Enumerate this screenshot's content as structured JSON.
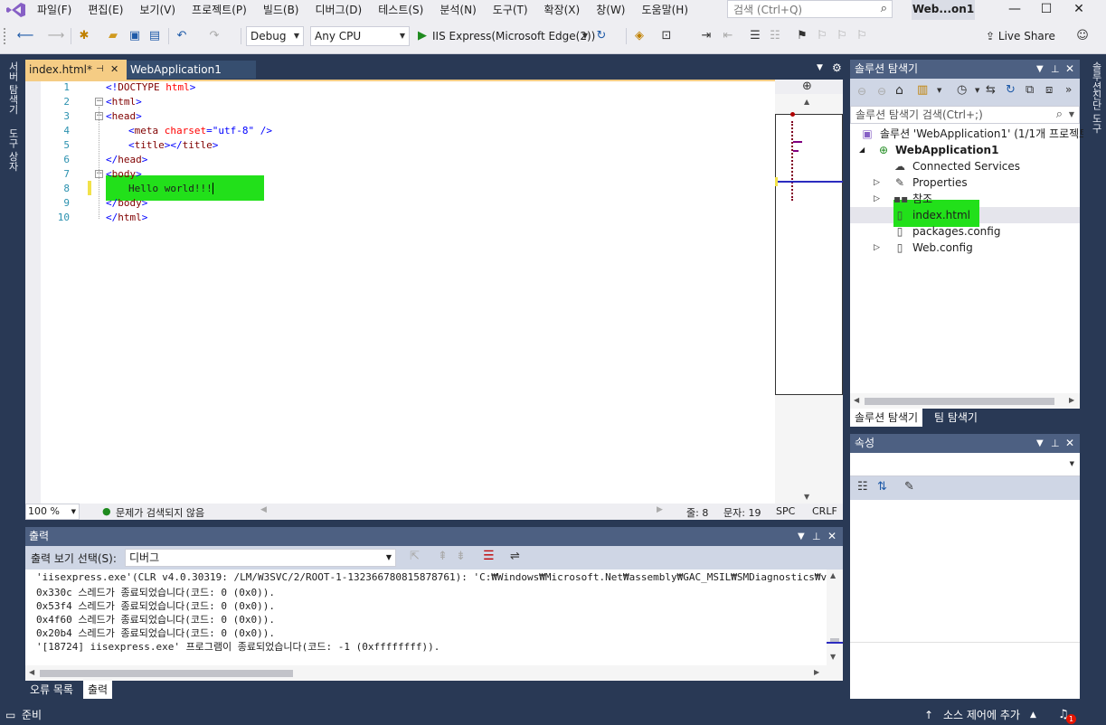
{
  "menubar": {
    "items": [
      "파일(F)",
      "편집(E)",
      "보기(V)",
      "프로젝트(P)",
      "빌드(B)",
      "디버그(D)",
      "테스트(S)",
      "분석(N)",
      "도구(T)",
      "확장(X)",
      "창(W)",
      "도움말(H)"
    ],
    "search_placeholder": "검색 (Ctrl+Q)",
    "window_title": "Web...on1"
  },
  "toolbar": {
    "config": "Debug",
    "platform": "Any CPU",
    "run_label": "IIS Express(Microsoft Edge(2))",
    "live_share": "Live Share"
  },
  "left_tabs": [
    "서버 탐색기",
    "도구 상자"
  ],
  "right_tabs": [
    "솔루션",
    "진단 도구"
  ],
  "editor": {
    "active_tab": "index.html*",
    "other_tab": "WebApplication1",
    "line_numbers": [
      "1",
      "2",
      "3",
      "4",
      "5",
      "6",
      "7",
      "8",
      "9",
      "10"
    ],
    "zoom": "100 %",
    "issues": "문제가 검색되지 않음",
    "line_label": "줄: 8",
    "col_label": "문자: 19",
    "spc": "SPC",
    "crlf": "CRLF"
  },
  "output": {
    "title": "출력",
    "source_label": "출력 보기 선택(S):",
    "source_value": "디버그",
    "lines": [
      "'iisexpress.exe'(CLR v4.0.30319: /LM/W3SVC/2/ROOT-1-132366780815878761): 'C:₩Windows₩Microsoft.Net₩assembly₩GAC_MSIL₩SMDiagnostics₩v4.0_4",
      "0x330c 스레드가 종료되었습니다(코드: 0 (0x0)).",
      "0x53f4 스레드가 종료되었습니다(코드: 0 (0x0)).",
      "0x4f60 스레드가 종료되었습니다(코드: 0 (0x0)).",
      "0x20b4 스레드가 종료되었습니다(코드: 0 (0x0)).",
      "'[18724] iisexpress.exe' 프로그램이 종료되었습니다(코드: -1 (0xffffffff))."
    ],
    "tabs": [
      "오류 목록",
      "출력"
    ]
  },
  "solution_explorer": {
    "title": "솔루션 탐색기",
    "search_placeholder": "솔루션 탐색기 검색(Ctrl+;)",
    "solution": "솔루션 'WebApplication1' (1/1개 프로젝트",
    "project": "WebApplication1",
    "items": [
      "Connected Services",
      "Properties",
      "참조",
      "index.html",
      "packages.config",
      "Web.config"
    ],
    "tabs": [
      "솔루션 탐색기",
      "팀 탐색기"
    ]
  },
  "properties": {
    "title": "속성"
  },
  "statusbar": {
    "ready": "준비",
    "source_control": "소스 제어에 추가",
    "notifications": "1"
  }
}
